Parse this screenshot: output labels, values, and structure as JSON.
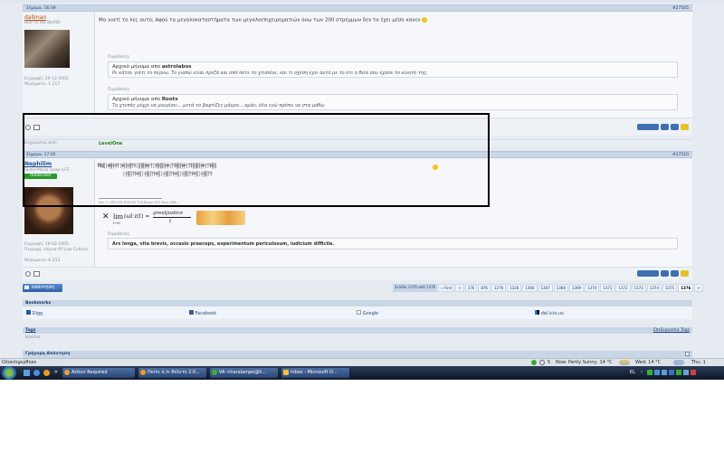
{
  "post1": {
    "date": "Σήμερα, 16:39",
    "number": "#27505",
    "username": "dallman",
    "user_title": "BleP In My WoRlD",
    "joined": "Εγγραφή: 29-12-2005",
    "messages": "Μηνύματα: 1.217",
    "message": "Μα γιατί το λες αυτό; Αφού τα μεγαλοκαταστήματα των μεγαλοεπιχειρηματιών όνω των 200 στρέμμων δεν τα έχει μέσο κανεν",
    "quote1_header": "Παράθεση:",
    "quote1_prefix": "Αρχικό μήνυμα απο",
    "quote1_author": "astrolabos",
    "quote1_text": "Ρε κάτσε γιατί το πέρνω. Το γιαπώ είναι πρεζά και από πότε το χτυπάνε; και τι σχέση έχει αυτό με το ότι η θεία σου έχασε το κινητό της;",
    "quote2_header": "Παράθεση:",
    "quote2_prefix": "Αρχικό μήνυμα απο",
    "quote2_author": "Rootx",
    "quote2_text": "Το χτυπάς μέχρι να μουρίσει... μετά το βαφτίζες μάυρο... αμάν, όλα εγώ πρέπει να στα μάθω"
  },
  "thanks_row": {
    "label": "Ευχαριστώ από:",
    "name": "LevelOne"
  },
  "post2": {
    "date": "Σήμερα, 17:05",
    "number": "#27510",
    "username": "Nephilim",
    "user_title": "Sinfo•Maria Soap•LFE",
    "badge": "moderator",
    "joined": "Εγγραφή: 16-02-2005",
    "location": "Περιοχή: House Of Low Culture",
    "messages": "Μηνύματα: 6.553",
    "message_prefix": "Μα",
    "sig_line": "lion u' η@2106 @@550 Tt'8 Boost 105 Asus A8N...",
    "formula_lim": "lim",
    "formula_sub": "t→0",
    "formula_func": "(ωl⋅z(t) =",
    "formula_num": "greatjustice",
    "formula_den": "t",
    "sig_quote_header": "Παράθεση:",
    "sig_quote_text": "Ars longa, vita brevis, occasio praeceps, experimentum periculosum, iudicium difficile."
  },
  "reply_button": "απάντηση",
  "pagination": {
    "label": "Σελίδα 1376 από 1376",
    "first": "« First",
    "pages": [
      "<",
      "376",
      "876",
      "1276",
      "1326",
      "1366",
      "1367",
      "1368",
      "1369",
      "1370",
      "1371",
      "1372",
      "1373",
      "1374",
      "1375",
      "1376",
      ">"
    ]
  },
  "bookmarks": {
    "title": "Bookmarks",
    "items": [
      "Digg",
      "Facebook",
      "Google",
      "del.icio.us"
    ]
  },
  "tags": {
    "title": "Tags",
    "edit": "Επεξεργασία Tags",
    "value": "Κανένα"
  },
  "quick_reply": "Γρήγορη Απάντηση",
  "statusbar": {
    "left": "Ολοκληρώθηκε",
    "zone": "5",
    "weather_now": "Now: Partly Sunny, 14 °C",
    "weather_wed": "Wed: 14 °C",
    "weather_thu": "Thu: 1"
  },
  "taskbar": {
    "items": [
      "Action Required",
      "Πείτε ό,τι θέλετε 2.0...",
      "VA <haralampo@h...",
      "Inbox - Microsoft O..."
    ],
    "lang": "EL"
  }
}
